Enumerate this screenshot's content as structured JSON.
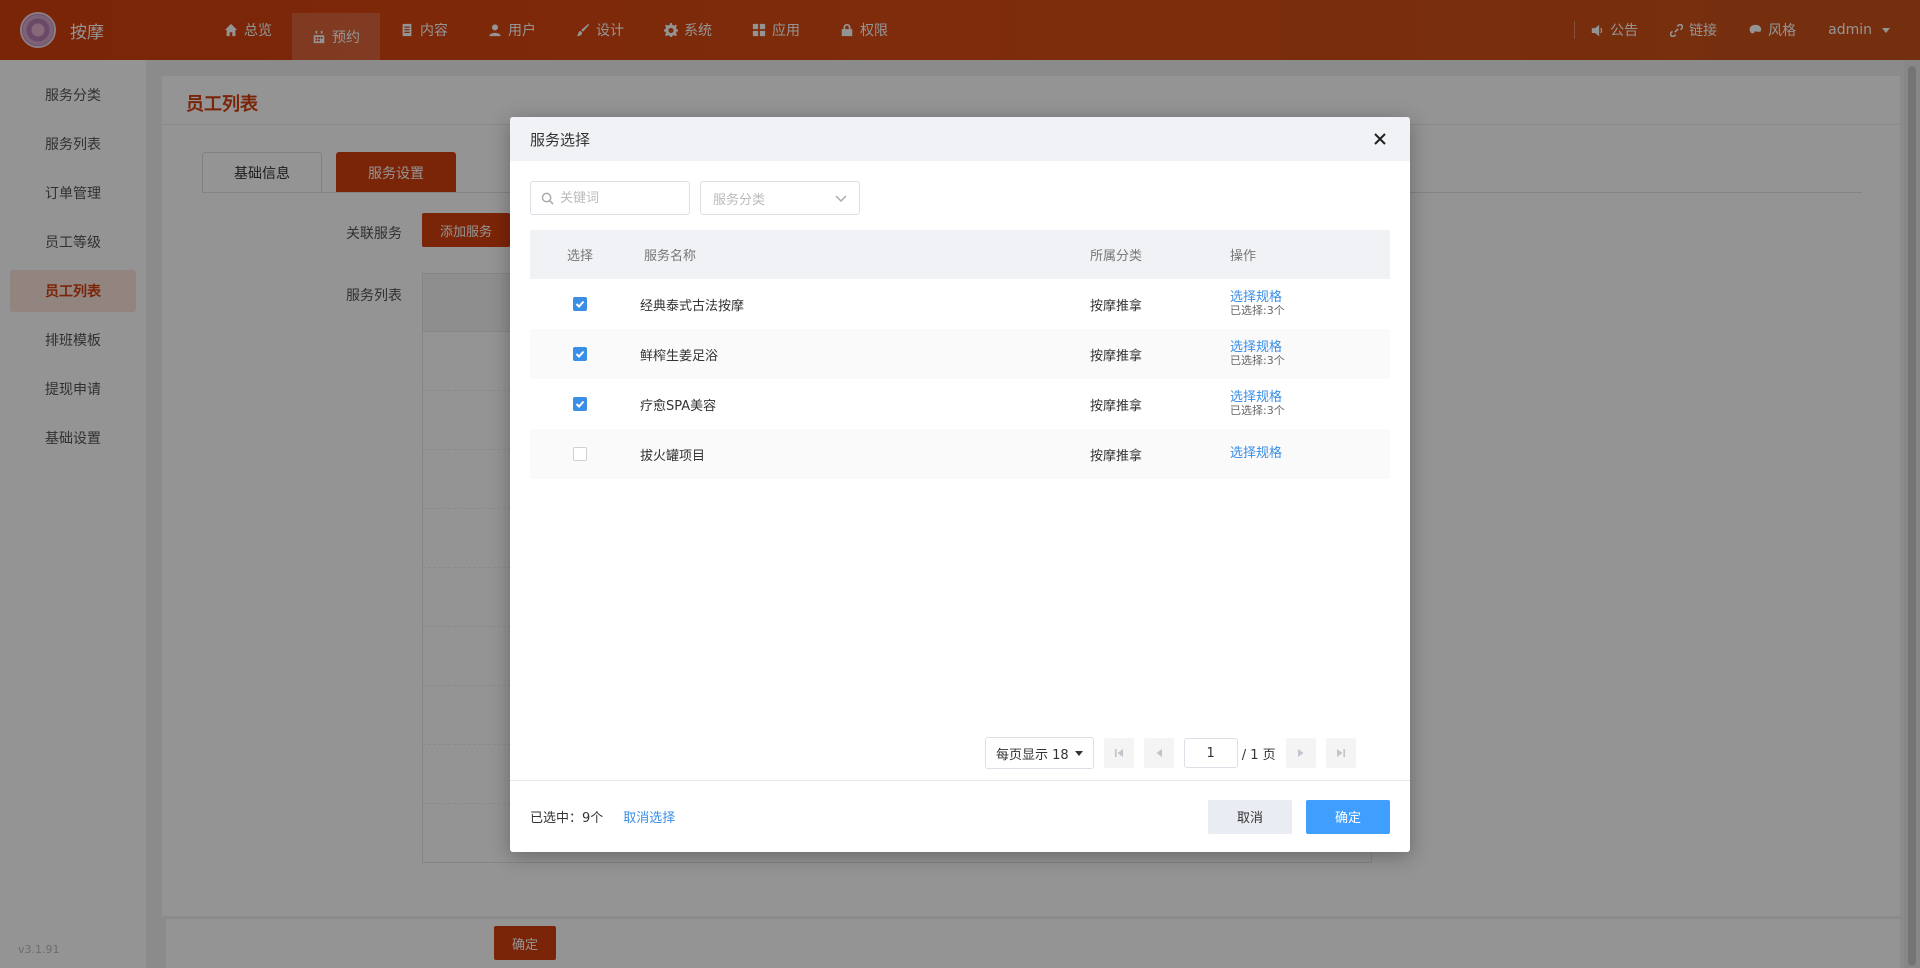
{
  "app": {
    "title": "按摩"
  },
  "nav": {
    "items": [
      {
        "label": "总览",
        "icon": "home-icon"
      },
      {
        "label": "预约",
        "icon": "calendar-icon",
        "active": true
      },
      {
        "label": "内容",
        "icon": "document-icon"
      },
      {
        "label": "用户",
        "icon": "user-icon"
      },
      {
        "label": "设计",
        "icon": "paint-brush-icon"
      },
      {
        "label": "系统",
        "icon": "gear-icon"
      },
      {
        "label": "应用",
        "icon": "apps-grid-icon"
      },
      {
        "label": "权限",
        "icon": "lock-icon"
      }
    ],
    "right": {
      "notice": "公告",
      "links": "链接",
      "style": "风格",
      "user": "admin"
    }
  },
  "sidebar": {
    "items": [
      {
        "label": "服务分类"
      },
      {
        "label": "服务列表"
      },
      {
        "label": "订单管理"
      },
      {
        "label": "员工等级"
      },
      {
        "label": "员工列表",
        "active": true
      },
      {
        "label": "排班模板"
      },
      {
        "label": "提现申请"
      },
      {
        "label": "基础设置"
      }
    ],
    "version": "v3.1.91"
  },
  "main": {
    "title": "员工列表",
    "tabs": [
      {
        "label": "基础信息"
      },
      {
        "label": "服务设置",
        "active": true
      }
    ],
    "related_label": "关联服务",
    "add_button": "添加服务",
    "list_label": "服务列表",
    "confirm_button": "确定"
  },
  "modal": {
    "title": "服务选择",
    "search": {
      "placeholder": "关键词"
    },
    "category_select": {
      "placeholder": "服务分类"
    },
    "columns": {
      "select": "选择",
      "name": "服务名称",
      "category": "所属分类",
      "action": "操作"
    },
    "rows": [
      {
        "name": "经典泰式古法按摩",
        "category": "按摩推拿",
        "action": "选择规格",
        "selected_info": "已选择:3个",
        "checked": true
      },
      {
        "name": "鲜榨生姜足浴",
        "category": "按摩推拿",
        "action": "选择规格",
        "selected_info": "已选择:3个",
        "checked": true
      },
      {
        "name": "疗愈SPA美容",
        "category": "按摩推拿",
        "action": "选择规格",
        "selected_info": "已选择:3个",
        "checked": true
      },
      {
        "name": "拔火罐项目",
        "category": "按摩推拿",
        "action": "选择规格",
        "selected_info": "",
        "checked": false
      }
    ],
    "pager": {
      "page_size_label": "每页显示 18",
      "current_page": "1",
      "total_label": "/ 1 页"
    },
    "footer": {
      "selected_count": "已选中：9个",
      "clear_selection": "取消选择",
      "cancel": "取消",
      "ok": "确定"
    }
  },
  "colors": {
    "brand": "#d4400e",
    "link": "#3a8ee6",
    "primary_button": "#409eff"
  }
}
